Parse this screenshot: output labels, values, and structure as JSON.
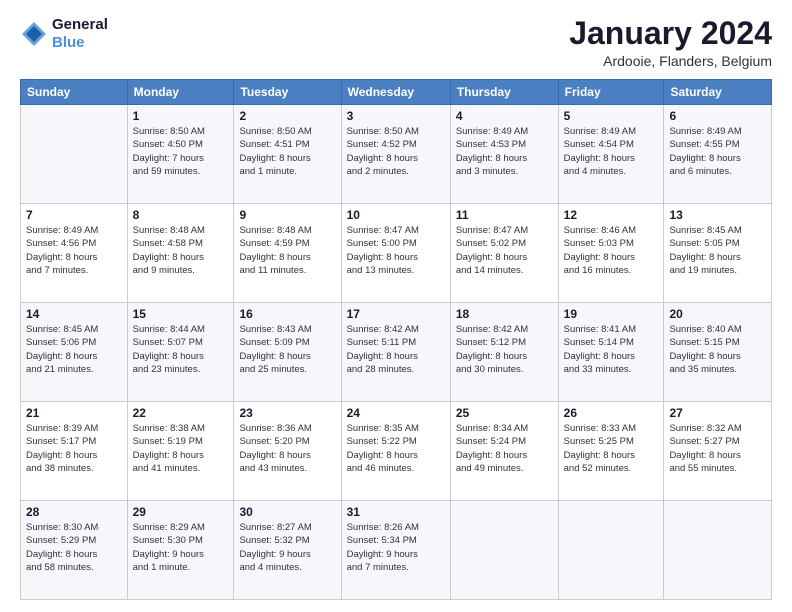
{
  "logo": {
    "line1": "General",
    "line2": "Blue"
  },
  "title": "January 2024",
  "subtitle": "Ardooie, Flanders, Belgium",
  "days_header": [
    "Sunday",
    "Monday",
    "Tuesday",
    "Wednesday",
    "Thursday",
    "Friday",
    "Saturday"
  ],
  "weeks": [
    [
      {
        "day": "",
        "info": ""
      },
      {
        "day": "1",
        "info": "Sunrise: 8:50 AM\nSunset: 4:50 PM\nDaylight: 7 hours\nand 59 minutes."
      },
      {
        "day": "2",
        "info": "Sunrise: 8:50 AM\nSunset: 4:51 PM\nDaylight: 8 hours\nand 1 minute."
      },
      {
        "day": "3",
        "info": "Sunrise: 8:50 AM\nSunset: 4:52 PM\nDaylight: 8 hours\nand 2 minutes."
      },
      {
        "day": "4",
        "info": "Sunrise: 8:49 AM\nSunset: 4:53 PM\nDaylight: 8 hours\nand 3 minutes."
      },
      {
        "day": "5",
        "info": "Sunrise: 8:49 AM\nSunset: 4:54 PM\nDaylight: 8 hours\nand 4 minutes."
      },
      {
        "day": "6",
        "info": "Sunrise: 8:49 AM\nSunset: 4:55 PM\nDaylight: 8 hours\nand 6 minutes."
      }
    ],
    [
      {
        "day": "7",
        "info": "Sunrise: 8:49 AM\nSunset: 4:56 PM\nDaylight: 8 hours\nand 7 minutes."
      },
      {
        "day": "8",
        "info": "Sunrise: 8:48 AM\nSunset: 4:58 PM\nDaylight: 8 hours\nand 9 minutes."
      },
      {
        "day": "9",
        "info": "Sunrise: 8:48 AM\nSunset: 4:59 PM\nDaylight: 8 hours\nand 11 minutes."
      },
      {
        "day": "10",
        "info": "Sunrise: 8:47 AM\nSunset: 5:00 PM\nDaylight: 8 hours\nand 13 minutes."
      },
      {
        "day": "11",
        "info": "Sunrise: 8:47 AM\nSunset: 5:02 PM\nDaylight: 8 hours\nand 14 minutes."
      },
      {
        "day": "12",
        "info": "Sunrise: 8:46 AM\nSunset: 5:03 PM\nDaylight: 8 hours\nand 16 minutes."
      },
      {
        "day": "13",
        "info": "Sunrise: 8:45 AM\nSunset: 5:05 PM\nDaylight: 8 hours\nand 19 minutes."
      }
    ],
    [
      {
        "day": "14",
        "info": "Sunrise: 8:45 AM\nSunset: 5:06 PM\nDaylight: 8 hours\nand 21 minutes."
      },
      {
        "day": "15",
        "info": "Sunrise: 8:44 AM\nSunset: 5:07 PM\nDaylight: 8 hours\nand 23 minutes."
      },
      {
        "day": "16",
        "info": "Sunrise: 8:43 AM\nSunset: 5:09 PM\nDaylight: 8 hours\nand 25 minutes."
      },
      {
        "day": "17",
        "info": "Sunrise: 8:42 AM\nSunset: 5:11 PM\nDaylight: 8 hours\nand 28 minutes."
      },
      {
        "day": "18",
        "info": "Sunrise: 8:42 AM\nSunset: 5:12 PM\nDaylight: 8 hours\nand 30 minutes."
      },
      {
        "day": "19",
        "info": "Sunrise: 8:41 AM\nSunset: 5:14 PM\nDaylight: 8 hours\nand 33 minutes."
      },
      {
        "day": "20",
        "info": "Sunrise: 8:40 AM\nSunset: 5:15 PM\nDaylight: 8 hours\nand 35 minutes."
      }
    ],
    [
      {
        "day": "21",
        "info": "Sunrise: 8:39 AM\nSunset: 5:17 PM\nDaylight: 8 hours\nand 38 minutes."
      },
      {
        "day": "22",
        "info": "Sunrise: 8:38 AM\nSunset: 5:19 PM\nDaylight: 8 hours\nand 41 minutes."
      },
      {
        "day": "23",
        "info": "Sunrise: 8:36 AM\nSunset: 5:20 PM\nDaylight: 8 hours\nand 43 minutes."
      },
      {
        "day": "24",
        "info": "Sunrise: 8:35 AM\nSunset: 5:22 PM\nDaylight: 8 hours\nand 46 minutes."
      },
      {
        "day": "25",
        "info": "Sunrise: 8:34 AM\nSunset: 5:24 PM\nDaylight: 8 hours\nand 49 minutes."
      },
      {
        "day": "26",
        "info": "Sunrise: 8:33 AM\nSunset: 5:25 PM\nDaylight: 8 hours\nand 52 minutes."
      },
      {
        "day": "27",
        "info": "Sunrise: 8:32 AM\nSunset: 5:27 PM\nDaylight: 8 hours\nand 55 minutes."
      }
    ],
    [
      {
        "day": "28",
        "info": "Sunrise: 8:30 AM\nSunset: 5:29 PM\nDaylight: 8 hours\nand 58 minutes."
      },
      {
        "day": "29",
        "info": "Sunrise: 8:29 AM\nSunset: 5:30 PM\nDaylight: 9 hours\nand 1 minute."
      },
      {
        "day": "30",
        "info": "Sunrise: 8:27 AM\nSunset: 5:32 PM\nDaylight: 9 hours\nand 4 minutes."
      },
      {
        "day": "31",
        "info": "Sunrise: 8:26 AM\nSunset: 5:34 PM\nDaylight: 9 hours\nand 7 minutes."
      },
      {
        "day": "",
        "info": ""
      },
      {
        "day": "",
        "info": ""
      },
      {
        "day": "",
        "info": ""
      }
    ]
  ]
}
